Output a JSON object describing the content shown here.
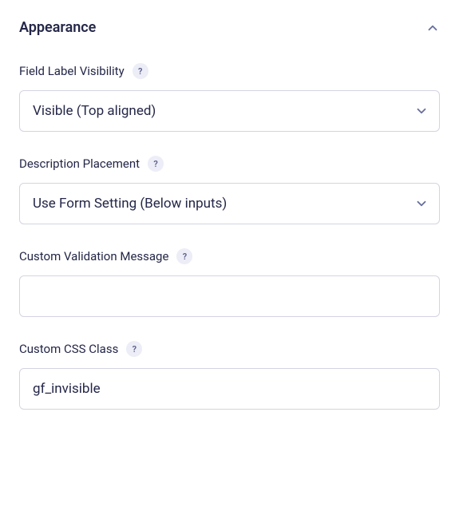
{
  "panel": {
    "title": "Appearance"
  },
  "fields": {
    "labelVisibility": {
      "label": "Field Label Visibility",
      "help": "?",
      "value": "Visible (Top aligned)"
    },
    "descriptionPlacement": {
      "label": "Description Placement",
      "help": "?",
      "value": "Use Form Setting (Below inputs)"
    },
    "validationMessage": {
      "label": "Custom Validation Message",
      "help": "?",
      "value": ""
    },
    "cssClass": {
      "label": "Custom CSS Class",
      "help": "?",
      "value": "gf_invisible"
    }
  }
}
